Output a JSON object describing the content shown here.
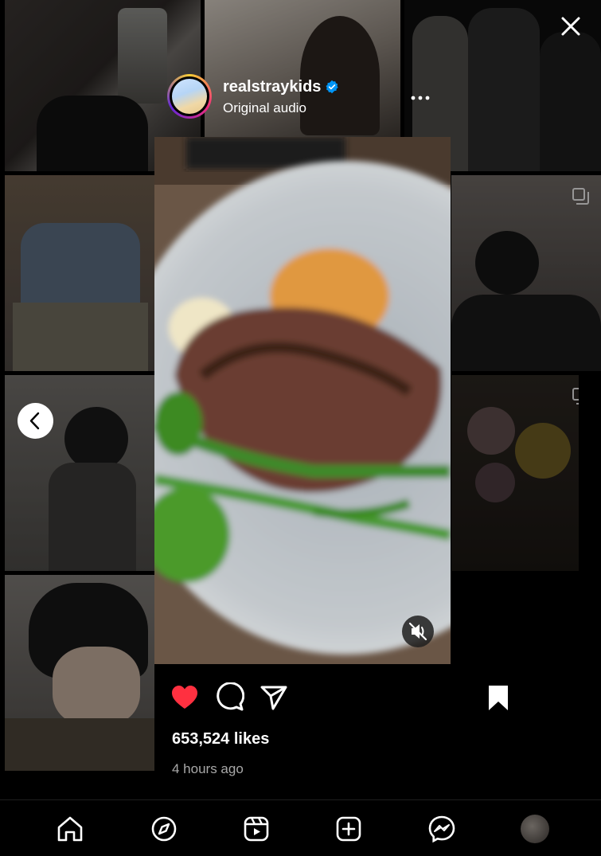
{
  "post": {
    "username": "realstraykids",
    "audio": "Original audio",
    "likes": "653,524 likes",
    "time": "4 hours ago",
    "liked": true,
    "saved": true,
    "muted": true
  },
  "icons": {
    "close": "close-icon",
    "more": "more-icon",
    "verified": "verified-badge-icon",
    "mute": "muted-speaker-icon",
    "prev": "chevron-left-icon",
    "like": "heart-filled-icon",
    "comment": "comment-icon",
    "share": "send-icon",
    "save": "bookmark-filled-icon"
  },
  "tabbar": [
    "home-icon",
    "explore-icon",
    "reels-icon",
    "create-icon",
    "messenger-icon",
    "profile-avatar"
  ],
  "colors": {
    "like": "#ff3040",
    "verified": "#0095f6",
    "background": "#000000"
  }
}
